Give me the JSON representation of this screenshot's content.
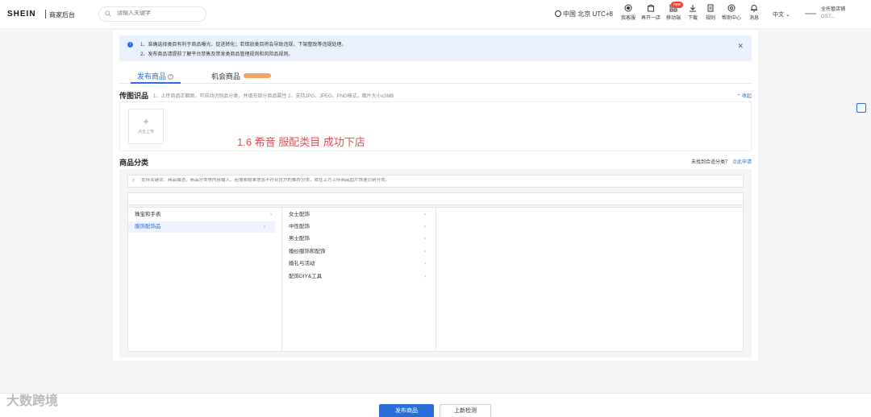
{
  "header": {
    "logo": "SHEIN",
    "logo_sub": "商家后台",
    "search_placeholder": "请输入关键字",
    "timezone": "中国 北京 UTC+8",
    "tools": [
      {
        "label": "我客服",
        "icon": "headset-icon"
      },
      {
        "label": "再开一店",
        "icon": "store-icon"
      },
      {
        "label": "移动端",
        "icon": "mobile-icon",
        "badge": "new"
      },
      {
        "label": "下载",
        "icon": "download-icon"
      },
      {
        "label": "规则",
        "icon": "document-icon"
      },
      {
        "label": "帮助中心",
        "icon": "help-center-icon"
      },
      {
        "label": "消息",
        "icon": "bell-icon"
      }
    ],
    "language": "中文",
    "account_name": "全托管店铺",
    "account_sub": "GS7..."
  },
  "notice": {
    "line1": "1、准确选择类目有利于商品曝光、促进转化；若错放类目将会导致违规，下架整改等违规处理。",
    "line2": "2、发布商品请提前了解平台禁售及禁发类商品管理规则和风险品规则。"
  },
  "tabs": {
    "publish": "发布商品",
    "opportunity": "机会商品"
  },
  "image_section": {
    "title": "传图识品",
    "hint": "1、上传商品正面图，可自动识别品分类，并填充部分商品属性  2、支持JPG、JPEG、PNG格式，图片大小≤3MB",
    "collapse": "收起",
    "upload_label": "点击上传"
  },
  "overlay_text": "1.6  希音  服配类目 成功下店",
  "category_section": {
    "title": "商品分类",
    "not_found": "未找到合适分类？",
    "apply": "点此申请",
    "search_placeholder": "支持关键词、商品描述、商品分类等内容输入，若搜索结果信息不符合官方的推荐分类，或在上方上传商品图片快速识别分类。",
    "col1": [
      {
        "label": "珠宝和手表",
        "selected": false
      },
      {
        "label": "服饰配饰品",
        "selected": true
      }
    ],
    "col2": [
      {
        "label": "女士配饰"
      },
      {
        "label": "中性配饰"
      },
      {
        "label": "男士配饰"
      },
      {
        "label": "婚纱服饰和配饰"
      },
      {
        "label": "婚礼与活动"
      },
      {
        "label": "配饰DIY&工具"
      }
    ]
  },
  "footer": {
    "publish_button": "发布商品",
    "check_button": "上新检测"
  },
  "watermark": "大数跨境",
  "colors": {
    "accent": "#2a6ed8",
    "notice_bg": "#e8f1fc",
    "overlay_red": "#e05050",
    "badge_red": "#e8473c"
  }
}
